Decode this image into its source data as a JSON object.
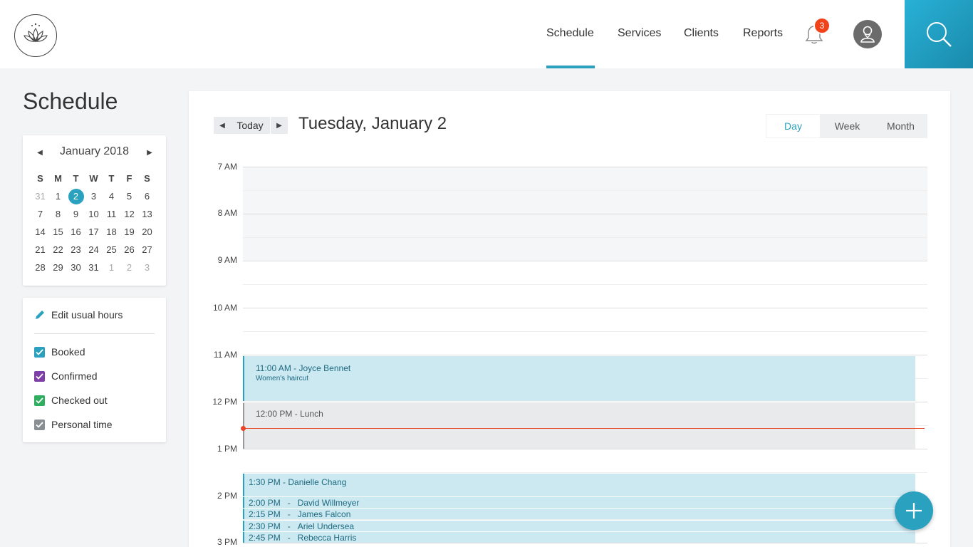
{
  "header": {
    "nav": [
      {
        "label": "Schedule",
        "active": true
      },
      {
        "label": "Services"
      },
      {
        "label": "Clients"
      },
      {
        "label": "Reports"
      }
    ],
    "notifications_count": "3",
    "icons": {
      "logo": "lotus-logo-icon",
      "bell": "bell-icon",
      "avatar": "user-avatar-icon",
      "search": "search-icon"
    }
  },
  "sidebar": {
    "title": "Schedule",
    "mini_calendar": {
      "month_label": "January 2018",
      "weekdays": [
        "S",
        "M",
        "T",
        "W",
        "T",
        "F",
        "S"
      ],
      "weeks": [
        [
          "31",
          "1",
          "2",
          "3",
          "4",
          "5",
          "6"
        ],
        [
          "7",
          "8",
          "9",
          "10",
          "11",
          "12",
          "13"
        ],
        [
          "14",
          "15",
          "16",
          "17",
          "18",
          "19",
          "20"
        ],
        [
          "21",
          "22",
          "23",
          "24",
          "25",
          "26",
          "27"
        ],
        [
          "28",
          "29",
          "30",
          "31",
          "1",
          "2",
          "3"
        ]
      ],
      "selected_day": "2"
    },
    "edit_hours_label": "Edit usual hours",
    "filters": [
      {
        "label": "Booked",
        "checked": true,
        "color": "#2aa1bf"
      },
      {
        "label": "Confirmed",
        "checked": true,
        "color": "#7e3fa6"
      },
      {
        "label": "Checked out",
        "checked": true,
        "color": "#2fae5f"
      },
      {
        "label": "Personal time",
        "checked": true,
        "color": "#8a8f94"
      }
    ]
  },
  "main": {
    "today_label": "Today",
    "date_title": "Tuesday, January 2",
    "views": [
      {
        "label": "Day",
        "active": true
      },
      {
        "label": "Week"
      },
      {
        "label": "Month"
      }
    ],
    "hours": [
      "7 AM",
      "8 AM",
      "9 AM",
      "10 AM",
      "11 AM",
      "12 PM",
      "1 PM",
      "2 PM",
      "3 PM"
    ],
    "events": {
      "joyce": {
        "time": "11:00 AM",
        "name": "Joyce Bennet",
        "service": "Women's haircut"
      },
      "lunch": {
        "time": "12:00 PM",
        "name": "Lunch"
      },
      "danielle": {
        "time": "1:30 PM",
        "name": "Danielle Chang"
      },
      "david": {
        "time": "2:00 PM",
        "name": "David Willmeyer"
      },
      "james": {
        "time": "2:15 PM",
        "name": "James Falcon"
      },
      "ariel": {
        "time": "2:30 PM",
        "name": "Ariel Undersea"
      },
      "rebecca": {
        "time": "2:45 PM",
        "name": "Rebecca Harris"
      }
    }
  },
  "colors": {
    "accent": "#2aa1bf",
    "badge": "#f2421a",
    "now_line": "#e8452b"
  }
}
